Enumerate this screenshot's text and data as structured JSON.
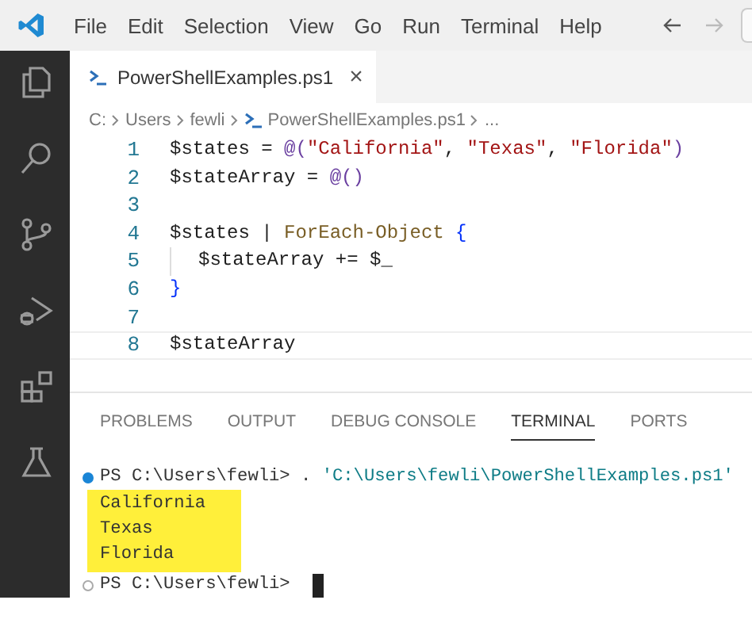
{
  "menu": [
    "File",
    "Edit",
    "Selection",
    "View",
    "Go",
    "Run",
    "Terminal",
    "Help"
  ],
  "nav": {
    "back": true,
    "forward": false
  },
  "activity_bar": [
    {
      "selected": false
    },
    {
      "selected": false
    },
    {
      "selected": false
    },
    {
      "selected": false
    },
    {
      "selected": false
    },
    {
      "selected": false
    }
  ],
  "editor_tab": {
    "label": "PowerShellExamples.ps1",
    "close": "×"
  },
  "breadcrumb": [
    "C:",
    "Users",
    "fewli",
    "PowerShellExamples.ps1",
    "..."
  ],
  "code": [
    {
      "number": "1",
      "current": false,
      "tokens": [
        {
          "kind": "var",
          "text": "$states"
        },
        {
          "kind": "op",
          "text": " = "
        },
        {
          "kind": "at",
          "text": "@("
        },
        {
          "kind": "str",
          "text": "\"California\""
        },
        {
          "kind": "op",
          "text": ", "
        },
        {
          "kind": "str",
          "text": "\"Texas\""
        },
        {
          "kind": "op",
          "text": ", "
        },
        {
          "kind": "str",
          "text": "\"Florida\""
        },
        {
          "kind": "at",
          "text": ")"
        }
      ]
    },
    {
      "number": "2",
      "current": false,
      "tokens": [
        {
          "kind": "var",
          "text": "$stateArray"
        },
        {
          "kind": "op",
          "text": " = "
        },
        {
          "kind": "at",
          "text": "@()"
        }
      ]
    },
    {
      "number": "3",
      "current": false
    },
    {
      "number": "4",
      "current": false,
      "tokens": [
        {
          "kind": "var",
          "text": "$states"
        },
        {
          "kind": "op",
          "text": " | "
        },
        {
          "kind": "cmd",
          "text": "ForEach-Object"
        },
        {
          "kind": "brace",
          "text": " {"
        }
      ]
    },
    {
      "number": "5",
      "current": false,
      "indent": true,
      "tokens": [
        {
          "kind": "var",
          "text": "$stateArray"
        },
        {
          "kind": "op",
          "text": " += "
        },
        {
          "kind": "var",
          "text": "$_"
        }
      ]
    },
    {
      "number": "6",
      "current": false,
      "tokens": [
        {
          "kind": "brace",
          "text": "}"
        }
      ]
    },
    {
      "number": "7",
      "current": false
    },
    {
      "number": "8",
      "current": true,
      "tokens": [
        {
          "kind": "var",
          "text": "$stateArray"
        }
      ]
    }
  ],
  "panel_tabs": [
    {
      "label": "PROBLEMS",
      "selected": false
    },
    {
      "label": "OUTPUT",
      "selected": false
    },
    {
      "label": "DEBUG CONSOLE",
      "selected": false
    },
    {
      "label": "TERMINAL",
      "selected": true
    },
    {
      "label": "PORTS",
      "selected": false
    }
  ],
  "terminal": [
    {
      "kind": "prompt",
      "succeeded": true,
      "prompt": "PS C:\\Users\\fewli>",
      "command": ". ",
      "argument": "'C:\\Users\\fewli\\PowerShellExamples.ps1'"
    },
    {
      "kind": "output",
      "highlighted": true,
      "lines": [
        "California",
        "Texas",
        "Florida"
      ]
    },
    {
      "kind": "prompt",
      "succeeded": false,
      "prompt": "PS C:\\Users\\fewli>",
      "cursor": true
    }
  ]
}
